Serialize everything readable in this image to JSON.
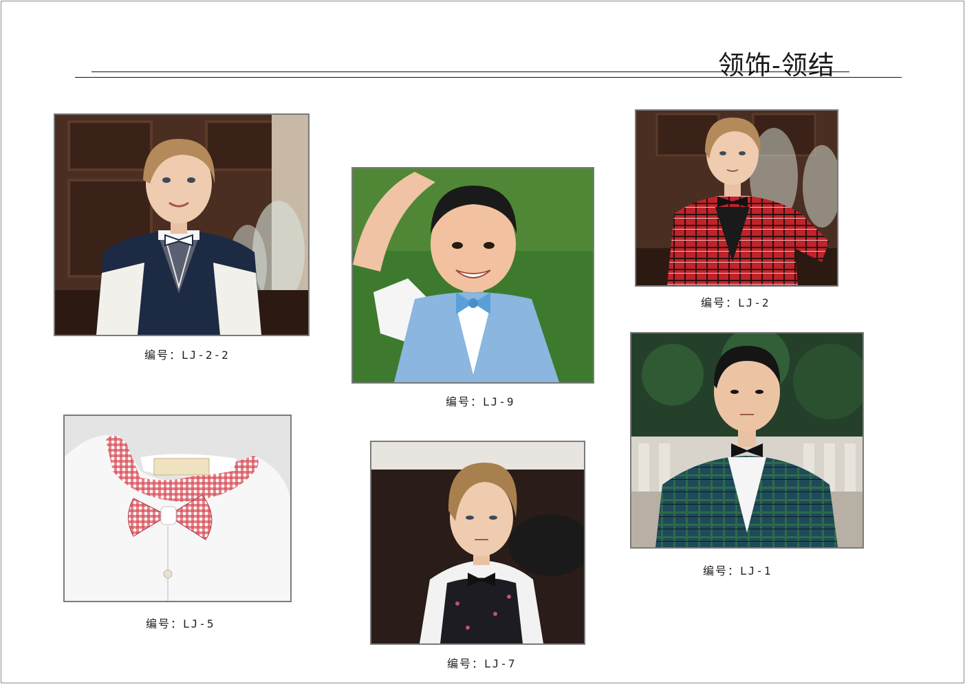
{
  "page": {
    "title": "领饰-领结"
  },
  "items": [
    {
      "caption": "编号：LJ-2-2"
    },
    {
      "caption": "编号：LJ-9"
    },
    {
      "caption": "编号：LJ-2"
    },
    {
      "caption": "编号：LJ-5"
    },
    {
      "caption": "编号：LJ-7"
    },
    {
      "caption": "编号：LJ-1"
    }
  ]
}
